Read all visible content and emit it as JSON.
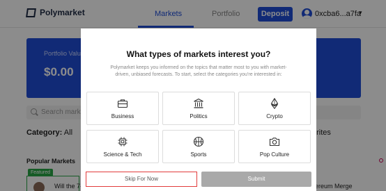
{
  "header": {
    "brand": "Polymarket",
    "nav": {
      "markets": "Markets",
      "portfolio": "Portfolio"
    },
    "deposit_label": "Deposit",
    "wallet": "0xcba6...a7fa"
  },
  "portfolio": {
    "label": "Portfolio Valu",
    "value": "$0.00"
  },
  "search": {
    "placeholder": "Search marke"
  },
  "filters": {
    "category_label": "Category:",
    "category_value": "All",
    "favorites": "orites"
  },
  "popular": {
    "title": "Popular Markets",
    "featured_badge": "Featured",
    "card_left_text": "Will the 7-",
    "card_right_text": "ereum Merge"
  },
  "modal": {
    "title": "What types of markets interest you?",
    "description": "Polymarket keeps you informed on the topics that matter most to you with market-driven, unbiased forecasts. To start, select the categories you're interested in:",
    "categories": [
      {
        "label": "Business",
        "icon": "briefcase-icon"
      },
      {
        "label": "Politics",
        "icon": "government-building-icon"
      },
      {
        "label": "Crypto",
        "icon": "ethereum-icon"
      },
      {
        "label": "Science & Tech",
        "icon": "chip-icon"
      },
      {
        "label": "Sports",
        "icon": "basketball-icon"
      },
      {
        "label": "Pop Culture",
        "icon": "camera-icon"
      }
    ],
    "skip_label": "Skip For Now",
    "submit_label": "Submit"
  },
  "colors": {
    "accent": "#1f4ed8",
    "featured": "#29a745",
    "skip_border": "#e23b3b",
    "submit_bg": "#a9a9a9"
  }
}
